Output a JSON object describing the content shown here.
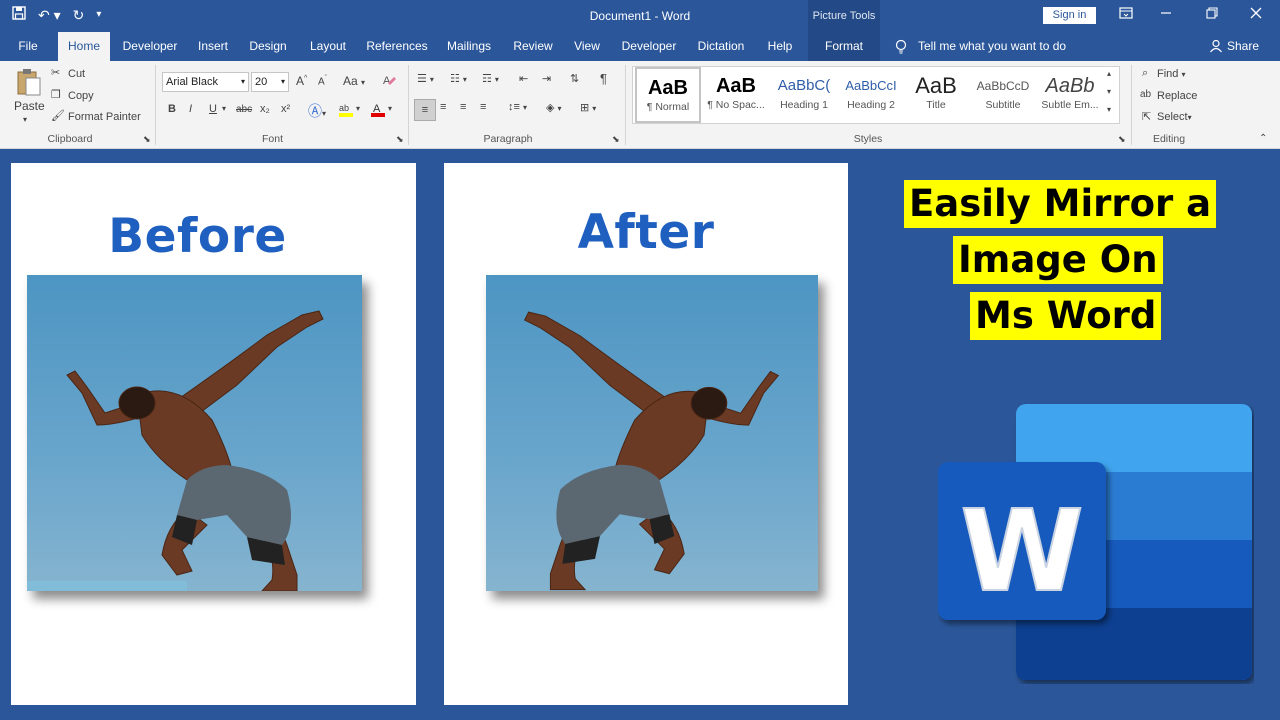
{
  "titlebar": {
    "doc_title": "Document1  -  Word",
    "picture_tools": "Picture Tools",
    "sign_in": "Sign in"
  },
  "tabs": [
    {
      "label": "File"
    },
    {
      "label": "Home"
    },
    {
      "label": "Developer"
    },
    {
      "label": "Insert"
    },
    {
      "label": "Design"
    },
    {
      "label": "Layout"
    },
    {
      "label": "References"
    },
    {
      "label": "Mailings"
    },
    {
      "label": "Review"
    },
    {
      "label": "View"
    },
    {
      "label": "Developer"
    },
    {
      "label": "Dictation"
    },
    {
      "label": "Help"
    },
    {
      "label": "Format"
    }
  ],
  "tell_me": "Tell me what you want to do",
  "share": "Share",
  "clipboard": {
    "paste": "Paste",
    "cut": "Cut",
    "copy": "Copy",
    "format_painter": "Format Painter",
    "label": "Clipboard"
  },
  "font": {
    "name": "Arial Black",
    "size": "20",
    "label": "Font",
    "grow": "A",
    "shrink": "A",
    "change_case": "Aa",
    "bold": "B",
    "italic": "I",
    "underline": "U",
    "strike": "abc",
    "subscript": "x₂",
    "superscript": "x²"
  },
  "paragraph": {
    "label": "Paragraph"
  },
  "styles": {
    "label": "Styles",
    "items": [
      {
        "preview": "AaB",
        "name": "¶ Normal"
      },
      {
        "preview": "AaB",
        "name": "¶ No Spac..."
      },
      {
        "preview": "AaBbC(",
        "name": "Heading 1"
      },
      {
        "preview": "AaBbCcI",
        "name": "Heading 2"
      },
      {
        "preview": "AaB",
        "name": "Title"
      },
      {
        "preview": "AaBbCcD",
        "name": "Subtitle"
      },
      {
        "preview": "AaBb",
        "name": "Subtle Em..."
      }
    ]
  },
  "editing": {
    "find": "Find",
    "replace": "Replace",
    "select": "Select",
    "label": "Editing"
  },
  "document": {
    "before_title": "Before",
    "after_title": "After"
  },
  "headline": {
    "line1": "Easily Mirror a",
    "line2": "Image On",
    "line3": "Ms Word"
  },
  "logo": {
    "letter": "W"
  },
  "colors": {
    "word_blue": "#2b579a",
    "headline_yellow": "#ffff00",
    "heading_blue": "#1f5fbf"
  }
}
